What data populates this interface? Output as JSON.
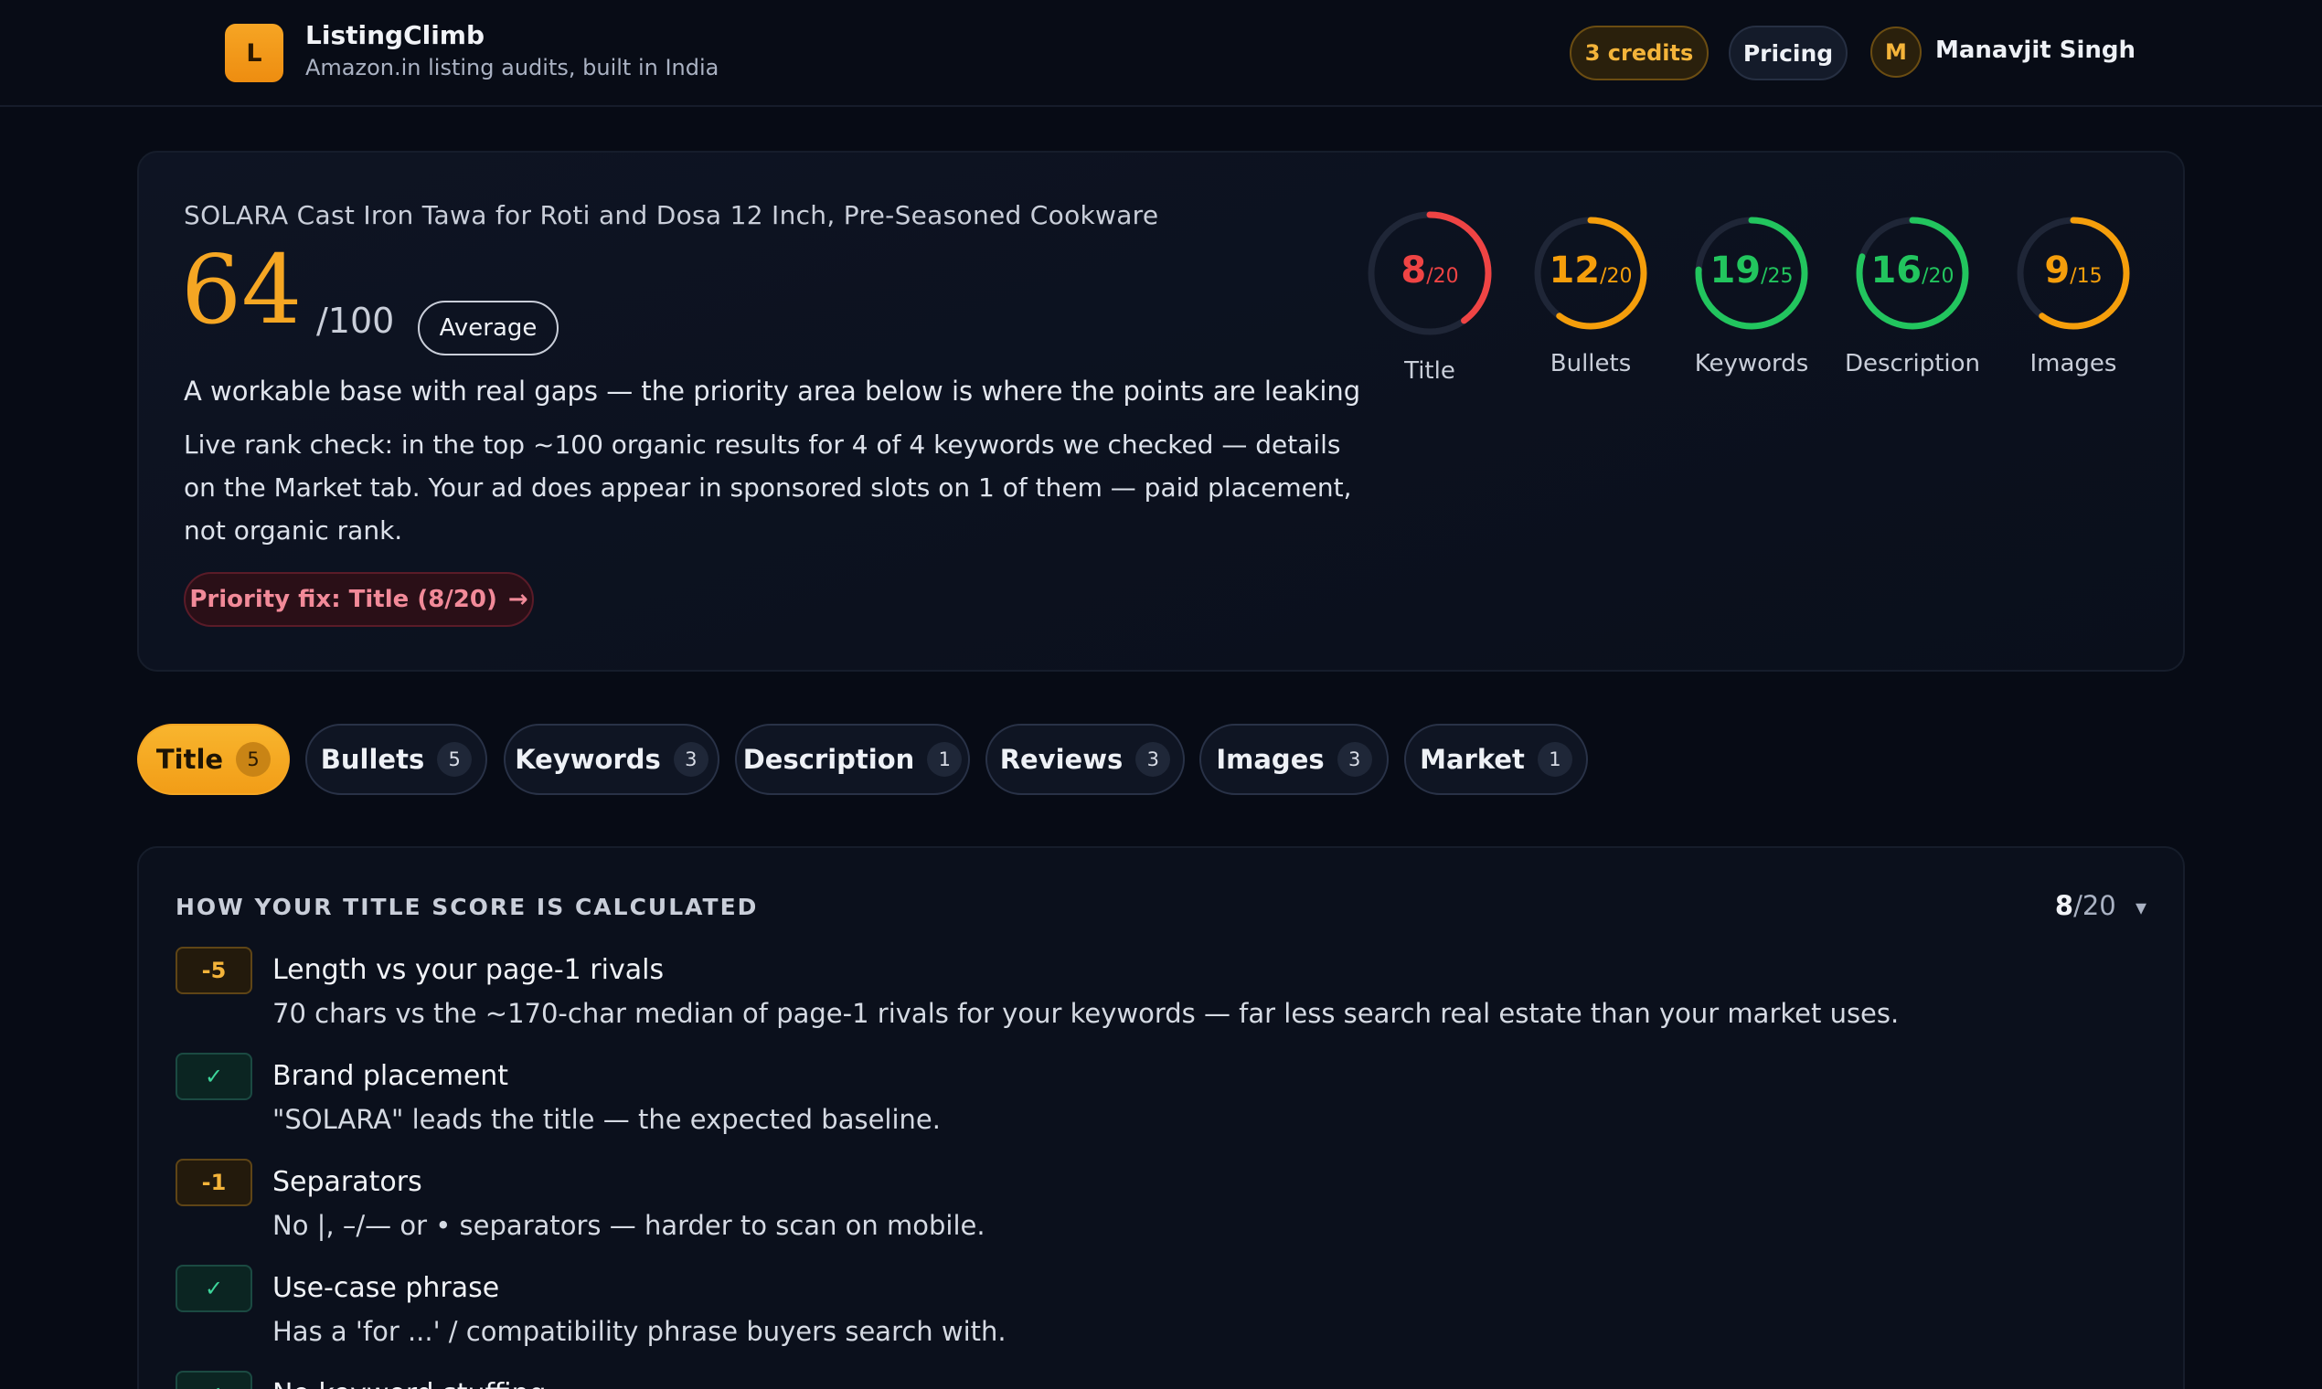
{
  "header": {
    "logo_letter": "L",
    "brand": "ListingClimb",
    "tagline": "Amazon.in listing audits, built in India",
    "credits": "3 credits",
    "pricing": "Pricing",
    "avatar_letter": "M",
    "user_name": "Manavjit Singh"
  },
  "summary": {
    "product_title": "SOLARA Cast Iron Tawa for Roti and Dosa 12 Inch, Pre-Seasoned Cookware",
    "score": "64",
    "score_max": "/100",
    "grade": "Average",
    "verdict": "A workable base with real gaps — the priority area below is where the points are leaking",
    "rank_note": "Live rank check: in the top ~100 organic results for 4 of 4 keywords we checked — details on the Market tab. Your ad does appear in sponsored slots on 1 of them — paid placement, not organic rank.",
    "priority_fix": "Priority fix: Title (8/20)",
    "priority_arrow": "→"
  },
  "gauges": [
    {
      "label": "Title",
      "score": 8,
      "max": 20,
      "score_text": "8",
      "max_text": "/20",
      "color": "#ef4444"
    },
    {
      "label": "Bullets",
      "score": 12,
      "max": 20,
      "score_text": "12",
      "max_text": "/20",
      "color": "#f59e0b"
    },
    {
      "label": "Keywords",
      "score": 19,
      "max": 25,
      "score_text": "19",
      "max_text": "/25",
      "color": "#22c55e"
    },
    {
      "label": "Description",
      "score": 16,
      "max": 20,
      "score_text": "16",
      "max_text": "/20",
      "color": "#22c55e"
    },
    {
      "label": "Images",
      "score": 9,
      "max": 15,
      "score_text": "9",
      "max_text": "/15",
      "color": "#f59e0b"
    }
  ],
  "tabs": [
    {
      "label": "Title",
      "count": "5"
    },
    {
      "label": "Bullets",
      "count": "5"
    },
    {
      "label": "Keywords",
      "count": "3"
    },
    {
      "label": "Description",
      "count": "1"
    },
    {
      "label": "Reviews",
      "count": "3"
    },
    {
      "label": "Images",
      "count": "3"
    },
    {
      "label": "Market",
      "count": "1"
    }
  ],
  "breakdown": {
    "heading": "HOW YOUR TITLE SCORE IS CALCULATED",
    "score": "8",
    "score_max": "/20",
    "toggle": "▾",
    "items": [
      {
        "badge": "-5",
        "title": "Length vs your page-1 rivals",
        "desc": "70 chars vs the ~170-char median of page-1 rivals for your keywords — far less search real estate than your market uses."
      },
      {
        "badge": "✓",
        "title": "Brand placement",
        "desc": "\"SOLARA\" leads the title — the expected baseline."
      },
      {
        "badge": "-1",
        "title": "Separators",
        "desc": "No |, –/— or • separators — harder to scan on mobile."
      },
      {
        "badge": "✓",
        "title": "Use-case phrase",
        "desc": "Has a 'for ...' / compatibility phrase buyers search with."
      },
      {
        "badge": "✓",
        "title": "No keyword stuffing",
        "desc": ""
      }
    ]
  }
}
